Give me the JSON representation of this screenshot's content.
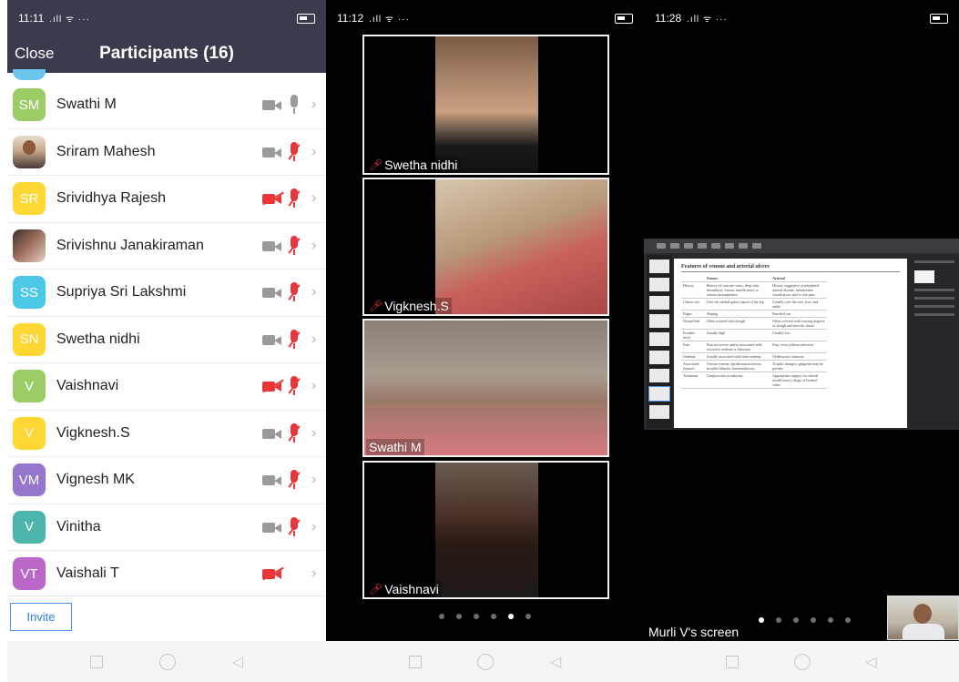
{
  "panel1": {
    "time": "11:11",
    "signal": ".ıll ᯤ ···",
    "close_label": "Close",
    "title": "Participants (16)",
    "invite_label": "Invite",
    "participants": [
      {
        "initials": "SM",
        "name": "Swathi M",
        "color": "#9ccc65",
        "video": "on",
        "audio": "on"
      },
      {
        "initials": "",
        "name": "Sriram Mahesh",
        "color": "#ffffff",
        "video": "on",
        "audio": "off",
        "photo": true
      },
      {
        "initials": "SR",
        "name": "Srividhya Rajesh",
        "color": "#fdd835",
        "video": "off",
        "audio": "off"
      },
      {
        "initials": "",
        "name": "Srivishnu Janakiraman",
        "color": "#ffffff",
        "video": "on",
        "audio": "off",
        "photo": true
      },
      {
        "initials": "SS",
        "name": "Supriya Sri Lakshmi",
        "color": "#4dc8e8",
        "video": "on",
        "audio": "off"
      },
      {
        "initials": "SN",
        "name": "Swetha nidhi",
        "color": "#fdd835",
        "video": "on",
        "audio": "off"
      },
      {
        "initials": "V",
        "name": "Vaishnavi",
        "color": "#9ccc65",
        "video": "off",
        "audio": "off"
      },
      {
        "initials": "V",
        "name": "Vigknesh.S",
        "color": "#fdd835",
        "video": "on",
        "audio": "off"
      },
      {
        "initials": "VM",
        "name": "Vignesh MK",
        "color": "#9575cd",
        "video": "on",
        "audio": "off"
      },
      {
        "initials": "V",
        "name": "Vinitha",
        "color": "#4db6ac",
        "video": "on",
        "audio": "off"
      },
      {
        "initials": "VT",
        "name": "Vaishali T",
        "color": "#ba68c8",
        "video": "off",
        "audio": "none"
      }
    ]
  },
  "panel2": {
    "time": "11:12",
    "signal": ".ıll ᯤ ···",
    "tiles": [
      {
        "name": "Swetha nidhi",
        "muted": true
      },
      {
        "name": "Vigknesh.S",
        "muted": true
      },
      {
        "name": "Swathi M",
        "muted": false
      },
      {
        "name": "Vaishnavi",
        "muted": true
      }
    ],
    "page_count": 6,
    "active_page": 5
  },
  "panel3": {
    "time": "11:28",
    "signal": ".ıll ᯤ ···",
    "screen_label": "Murli V's screen",
    "page_count": 6,
    "active_page": 1,
    "slide": {
      "title": "Features of venous and arterial ulcers",
      "headers": [
        "",
        "Venous",
        "Arterial"
      ],
      "rows": [
        [
          "History",
          "History of varicose veins, deep vein thrombosis, venous insufficiency or venous incompetence",
          "History suggestive of peripheral arterial disease, intermittent claudication, and/or rest pain"
        ],
        [
          "Classic site",
          "Over the medial gaiter region of the leg",
          "Usually over the toes, foot, and ankle"
        ],
        [
          "Edges",
          "Sloping",
          "Punched out"
        ],
        [
          "Wound bed",
          "Often covered with slough",
          "Often covered with varying degrees of slough and necrotic tissue"
        ],
        [
          "Exudate level",
          "Usually high",
          "Usually low"
        ],
        [
          "Pain",
          "Pain not severe unless associated with excessive oedema or infection",
          "Pain, even without infection"
        ],
        [
          "Oedema",
          "Usually associated with limb oedema",
          "Oedema not common"
        ],
        [
          "Associated features",
          "Venous eczema, lipodermatosclerosis, atrophie blanche, haemosiderosis",
          "Trophic changes; gangrene may be present"
        ],
        [
          "Treatment",
          "Compression is mainstay",
          "Appropriate surgery for arterial insufficiency; drugs of limited value"
        ]
      ]
    }
  },
  "colors": {
    "header_bg": "#3b3b4f",
    "mute_red": "#e8363a",
    "icon_gray": "#9a9a9a",
    "invite_blue": "#2d7fd8"
  }
}
